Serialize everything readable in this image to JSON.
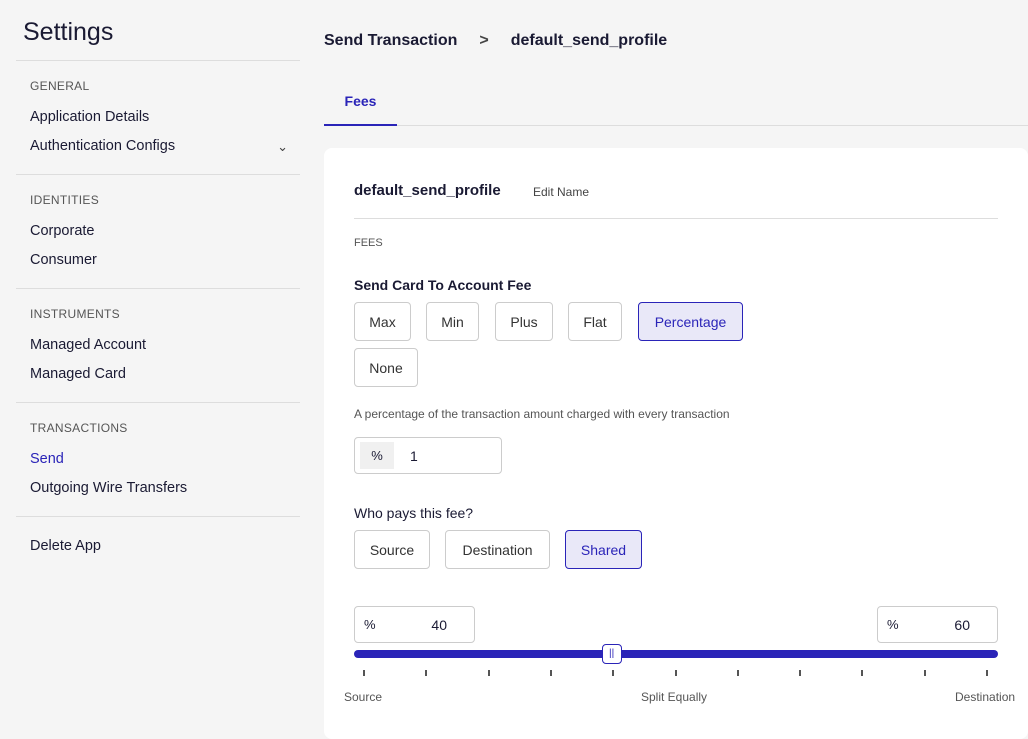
{
  "sidebar": {
    "title": "Settings",
    "sections": [
      {
        "heading": "GENERAL",
        "items": [
          "Application Details",
          "Authentication Configs"
        ]
      },
      {
        "heading": "IDENTITIES",
        "items": [
          "Corporate",
          "Consumer"
        ]
      },
      {
        "heading": "INSTRUMENTS",
        "items": [
          "Managed Account",
          "Managed Card"
        ]
      },
      {
        "heading": "TRANSACTIONS",
        "items": [
          "Send",
          "Outgoing Wire Transfers"
        ]
      },
      {
        "heading": "",
        "items": [
          "Delete App"
        ]
      }
    ],
    "active": "Send"
  },
  "breadcrumb": [
    "Send Transaction",
    "default_send_profile"
  ],
  "tabs": [
    "Fees"
  ],
  "card": {
    "profile_name": "default_send_profile",
    "edit_label": "Edit Name",
    "section": "FEES",
    "fee_label": "Send Card To Account Fee",
    "fee_types": [
      "Max",
      "Min",
      "Plus",
      "Flat",
      "Percentage",
      "None"
    ],
    "selected_fee": "Percentage",
    "fee_description": "A percentage of the transaction amount charged with every transaction",
    "fee_unit": "%",
    "fee_value": "1",
    "payer_label": "Who pays this fee?",
    "payers": [
      "Source",
      "Destination",
      "Shared"
    ],
    "selected_payer": "Shared",
    "source_unit": "%",
    "source_value": "40",
    "dest_unit": "%",
    "dest_value": "60",
    "split_percent": 40,
    "slider_labels": [
      "Source",
      "Split Equally",
      "Destination"
    ]
  },
  "colors": {
    "accent": "#2a24b8"
  }
}
